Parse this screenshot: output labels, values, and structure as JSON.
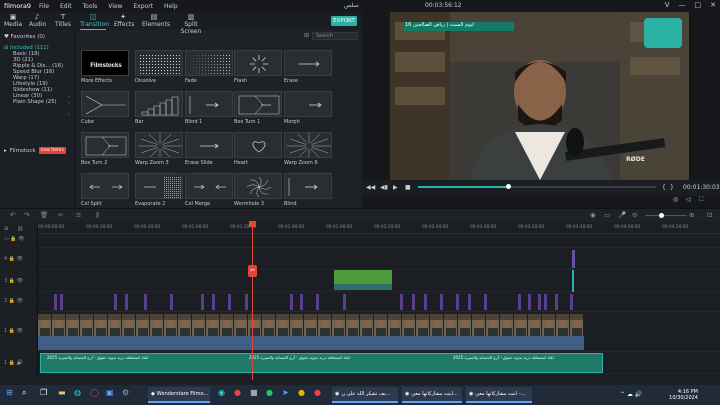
{
  "app": {
    "logo": "filmora9",
    "menu": [
      "File",
      "Edit",
      "Tools",
      "View",
      "Export",
      "Help"
    ],
    "project_name": "سلس",
    "timecode": "00:03:56:12",
    "window_buttons": [
      "ᐯ",
      "—",
      "□",
      "✕"
    ]
  },
  "tabs": [
    {
      "label": "Media",
      "icon": "▣"
    },
    {
      "label": "Audio",
      "icon": "♪"
    },
    {
      "label": "Titles",
      "icon": "T"
    },
    {
      "label": "Transition",
      "icon": "◫",
      "active": true
    },
    {
      "label": "Effects",
      "icon": "✦"
    },
    {
      "label": "Elements",
      "icon": "▤"
    },
    {
      "label": "Split Screen",
      "icon": "▥"
    }
  ],
  "export_label": "EXPORT",
  "sidebar": {
    "favorites": "♥ Favorites (0)",
    "categories": [
      {
        "label": "⊟ Included (111)",
        "head": true
      },
      {
        "label": "Basic (18)"
      },
      {
        "label": "3D (21)"
      },
      {
        "label": "Ripple & Dis... (16)"
      },
      {
        "label": "Speed Blur (16)"
      },
      {
        "label": "Warp (17)"
      },
      {
        "label": "Lifestyle (19)"
      },
      {
        "label": "Slideshow (11)"
      },
      {
        "label": "Linear (30)"
      },
      {
        "label": "Plain Shape (25)"
      }
    ],
    "filmstock": "Filmstock",
    "new_badge": "new items"
  },
  "search": {
    "placeholder": "Search"
  },
  "transitions": [
    {
      "label": "More Effects",
      "icon": "filmstocks-logo",
      "thumb": "Filmstocks"
    },
    {
      "label": "Dissolve",
      "icon": "dissolve-icon"
    },
    {
      "label": "Fade",
      "icon": "fade-icon"
    },
    {
      "label": "Flash",
      "icon": "flash-icon"
    },
    {
      "label": "Erase",
      "icon": "erase-icon"
    },
    {
      "label": "Cube",
      "icon": "cube-icon"
    },
    {
      "label": "Bar",
      "icon": "bar-icon"
    },
    {
      "label": "Blind 1",
      "icon": "blind-icon"
    },
    {
      "label": "Box Turn 1",
      "icon": "box-turn-icon"
    },
    {
      "label": "Morph",
      "icon": "morph-icon"
    },
    {
      "label": "Box Turn 2",
      "icon": "box-turn-icon"
    },
    {
      "label": "Warp Zoom 3",
      "icon": "warp-zoom-icon"
    },
    {
      "label": "Erase Slide",
      "icon": "erase-slide-icon"
    },
    {
      "label": "Heart",
      "icon": "heart-icon"
    },
    {
      "label": "Warp Zoom 6",
      "icon": "warp-zoom-icon"
    },
    {
      "label": "Col Split",
      "icon": "col-split-icon"
    },
    {
      "label": "Evaporate 2",
      "icon": "evaporate-icon"
    },
    {
      "label": "Col Merge",
      "icon": "col-merge-icon"
    },
    {
      "label": "Wormhole 3",
      "icon": "wormhole-icon"
    },
    {
      "label": "Blind",
      "icon": "blind-icon"
    }
  ],
  "preview": {
    "caption_top": "ليوم السبت | رياض الصالحين 16",
    "watermark": "RØDE",
    "time": "00:01:30:03",
    "progress": 0.38
  },
  "timeline": {
    "ticks": [
      "00:00:00:00",
      "00:00:20:00",
      "00:00:40:00",
      "00:01:00:00",
      "00:01:20:00",
      "00:01:40:00",
      "00:02:00:00",
      "00:02:20:00",
      "00:02:40:00",
      "00:03:00:00",
      "00:03:20:00",
      "00:03:40:00",
      "00:04:00:00",
      "00:04:20:00"
    ],
    "tracks": [
      "4",
      "3",
      "2",
      "1",
      "1"
    ],
    "audio_text": "لقاء استضافة درية بدوية حقوق - أرج الحسابة والسيرة 2025"
  },
  "taskbar": {
    "search": "Search",
    "tasks": [
      "Wonderstare Filmo...",
      "يف تشكر الله على ن...",
      "ابنت مشاركاتها معي...",
      "ابنت مشاركاتها معي -..."
    ],
    "time": "4:16 PM",
    "date": "10/30/2024"
  }
}
